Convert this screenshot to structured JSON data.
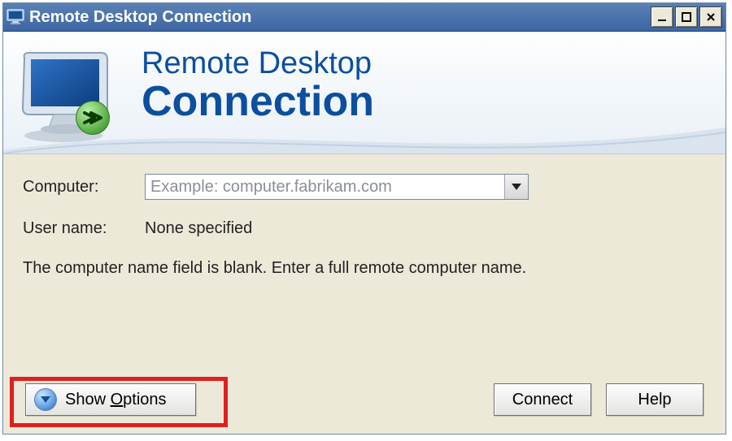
{
  "titlebar": {
    "title": "Remote Desktop Connection"
  },
  "banner": {
    "line1": "Remote Desktop",
    "line2": "Connection"
  },
  "form": {
    "computer_label": "Computer:",
    "computer_placeholder": "Example: computer.fabrikam.com",
    "computer_value": "",
    "user_label": "User name:",
    "user_value": "None specified",
    "hint": "The computer name field is blank. Enter a full remote computer name."
  },
  "buttons": {
    "show_options_prefix": "Show ",
    "show_options_ul": "O",
    "show_options_suffix": "ptions",
    "connect": "Connect",
    "help": "Help"
  }
}
